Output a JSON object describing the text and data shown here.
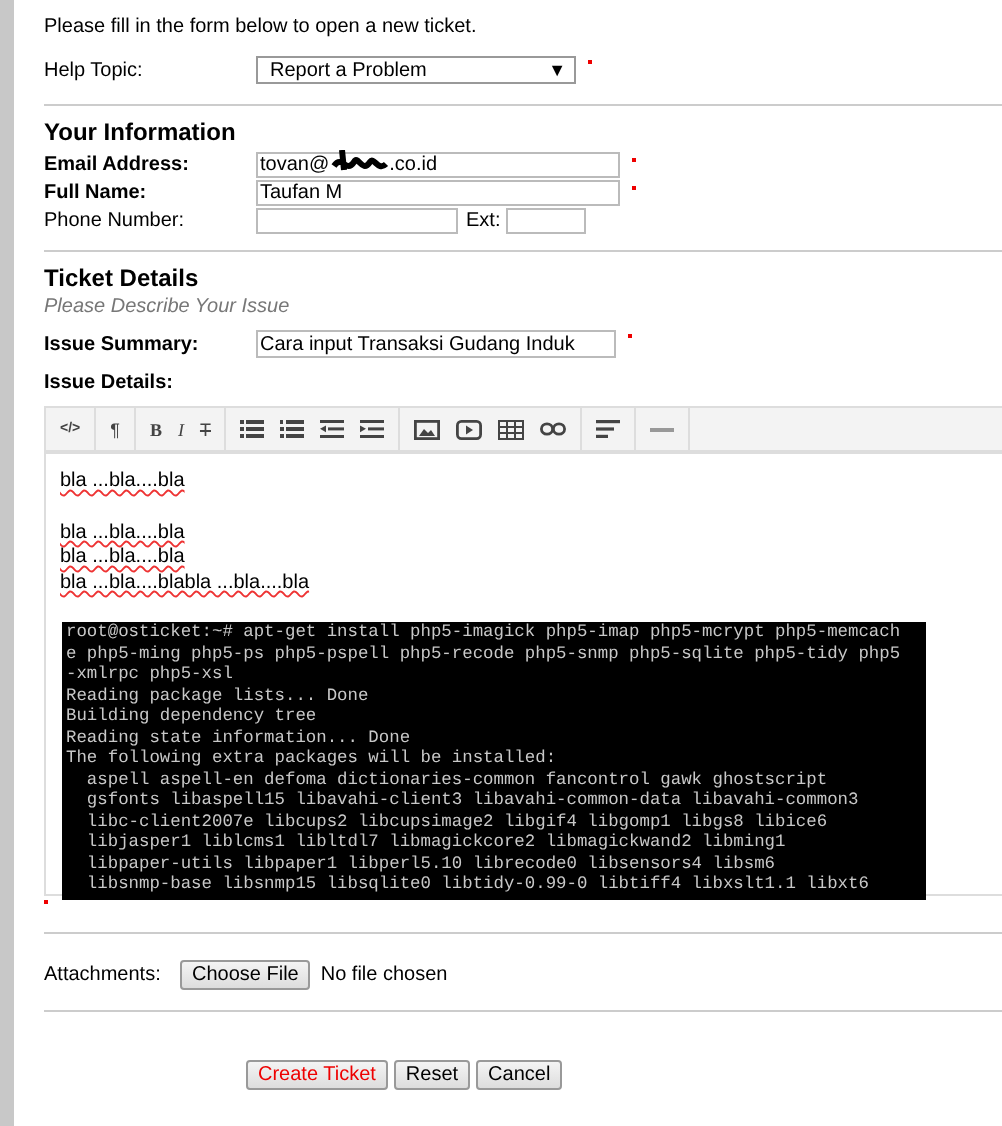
{
  "intro": "Please fill in the form below to open a new ticket.",
  "help_topic": {
    "label": "Help Topic:",
    "value": "Report a Problem",
    "arrow": "▼",
    "required": true
  },
  "your_information": {
    "heading": "Your Information",
    "email": {
      "label": "Email Address:",
      "value_start": "tovan@",
      "value_end": ".co.id",
      "required": true
    },
    "full_name": {
      "label": "Full Name:",
      "value": "Taufan M",
      "required": true
    },
    "phone": {
      "label": "Phone Number:",
      "ext_label": "Ext:"
    }
  },
  "ticket_details": {
    "heading": "Ticket Details",
    "subtitle": "Please Describe Your Issue",
    "issue_summary": {
      "label": "Issue Summary:",
      "value": "Cara input Transaksi Gudang Induk",
      "required": true
    },
    "issue_details": {
      "label": "Issue Details:",
      "required": true
    }
  },
  "toolbar": [
    [
      {
        "kind": "code",
        "label": "</>"
      }
    ],
    [
      {
        "kind": "text",
        "label": "¶"
      }
    ],
    [
      {
        "kind": "bold",
        "label": "B"
      },
      {
        "kind": "italic",
        "label": "I"
      },
      {
        "kind": "strike",
        "label": "T"
      }
    ],
    [
      {
        "kind": "bullet-list"
      },
      {
        "kind": "numbered-list"
      },
      {
        "kind": "outdent"
      },
      {
        "kind": "indent"
      }
    ],
    [
      {
        "kind": "image"
      },
      {
        "kind": "video"
      },
      {
        "kind": "table"
      },
      {
        "kind": "link"
      }
    ],
    [
      {
        "kind": "align"
      }
    ],
    [
      {
        "kind": "rule"
      }
    ]
  ],
  "editor_paragraphs": [
    [
      "bla ...bla....bla"
    ],
    [
      "bla ...bla....bla",
      "bla ...bla....bla",
      "bla ...bla....blabla ...bla....bla"
    ]
  ],
  "terminal_lines": [
    "root@osticket:~# apt-get install php5-imagick php5-imap php5-mcrypt php5-memcach",
    "e php5-ming php5-ps php5-pspell php5-recode php5-snmp php5-sqlite php5-tidy php5",
    "-xmlrpc php5-xsl",
    "Reading package lists... Done",
    "Building dependency tree",
    "Reading state information... Done",
    "The following extra packages will be installed:",
    "  aspell aspell-en defoma dictionaries-common fancontrol gawk ghostscript",
    "  gsfonts libaspell15 libavahi-client3 libavahi-common-data libavahi-common3",
    "  libc-client2007e libcups2 libcupsimage2 libgif4 libgomp1 libgs8 libice6",
    "  libjasper1 liblcms1 libltdl7 libmagickcore2 libmagickwand2 libming1",
    "  libpaper-utils libpaper1 libperl5.10 librecode0 libsensors4 libsm6",
    "  libsnmp-base libsnmp15 libsqlite0 libtidy-0.99-0 libtiff4 libxslt1.1 libxt6"
  ],
  "attachments": {
    "label": "Attachments:",
    "button": "Choose File",
    "status": "No file chosen"
  },
  "buttons": [
    {
      "label": "Create Ticket",
      "kind": "primary"
    },
    {
      "label": "Reset",
      "kind": "plain"
    },
    {
      "label": "Cancel",
      "kind": "plain"
    }
  ]
}
